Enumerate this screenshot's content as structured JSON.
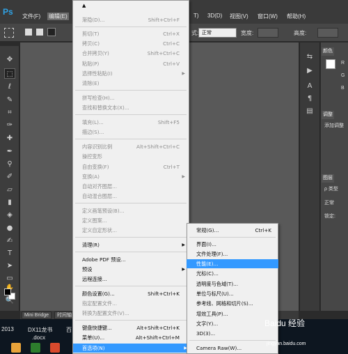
{
  "app": {
    "logo": "Ps"
  },
  "menubar": {
    "file": "文件(F)",
    "edit": "编辑(E)",
    "type_partial": "T)",
    "view3d": "3D(D)",
    "view": "视图(V)",
    "window": "窗口(W)",
    "help": "帮助(H)"
  },
  "options": {
    "mode_label": "式:",
    "mode_value": "正常",
    "opacity_label": "宽度:",
    "height_label": "高度:"
  },
  "edit_menu": {
    "items": [
      {
        "label": "渐隐(D)...",
        "shortcut": "Shift+Ctrl+F",
        "enabled": false
      },
      {
        "label": "剪切(T)",
        "shortcut": "Ctrl+X",
        "enabled": false
      },
      {
        "label": "拷贝(C)",
        "shortcut": "Ctrl+C",
        "enabled": false
      },
      {
        "label": "合并拷贝(Y)",
        "shortcut": "Shift+Ctrl+C",
        "enabled": false
      },
      {
        "label": "粘贴(P)",
        "shortcut": "Ctrl+V",
        "enabled": false
      },
      {
        "label": "选择性粘贴(I)",
        "shortcut": "",
        "enabled": false
      },
      {
        "label": "清除(E)",
        "shortcut": "",
        "enabled": false
      },
      {
        "label": "拼写检查(H)...",
        "shortcut": "",
        "enabled": false
      },
      {
        "label": "查找和替换文本(X)...",
        "shortcut": "",
        "enabled": false
      },
      {
        "label": "填充(L)...",
        "shortcut": "Shift+F5",
        "enabled": false
      },
      {
        "label": "描边(S)...",
        "shortcut": "",
        "enabled": false
      },
      {
        "label": "内容识别比例",
        "shortcut": "Alt+Shift+Ctrl+C",
        "enabled": false
      },
      {
        "label": "操控变形",
        "shortcut": "",
        "enabled": false
      },
      {
        "label": "自由变换(F)",
        "shortcut": "Ctrl+T",
        "enabled": false
      },
      {
        "label": "变换(A)",
        "shortcut": "",
        "enabled": false
      },
      {
        "label": "自动对齐图层...",
        "shortcut": "",
        "enabled": false
      },
      {
        "label": "自动混合图层...",
        "shortcut": "",
        "enabled": false
      },
      {
        "label": "定义画笔预设(B)...",
        "shortcut": "",
        "enabled": false
      },
      {
        "label": "定义图案...",
        "shortcut": "",
        "enabled": false
      },
      {
        "label": "定义自定形状...",
        "shortcut": "",
        "enabled": false
      },
      {
        "label": "清理(R)",
        "shortcut": "",
        "enabled": true
      },
      {
        "label": "Adobe PDF 预设...",
        "shortcut": "",
        "enabled": true
      },
      {
        "label": "预设",
        "shortcut": "",
        "enabled": true
      },
      {
        "label": "远程连接...",
        "shortcut": "",
        "enabled": true
      },
      {
        "label": "颜色设置(G)...",
        "shortcut": "Shift+Ctrl+K",
        "enabled": true
      },
      {
        "label": "指定配置文件...",
        "shortcut": "",
        "enabled": false
      },
      {
        "label": "转换为配置文件(V)...",
        "shortcut": "",
        "enabled": false
      },
      {
        "label": "键盘快捷键...",
        "shortcut": "Alt+Shift+Ctrl+K",
        "enabled": true
      },
      {
        "label": "菜单(U)...",
        "shortcut": "Alt+Shift+Ctrl+M",
        "enabled": true
      },
      {
        "label": "首选项(N)",
        "shortcut": "",
        "enabled": true,
        "highlighted": true
      }
    ]
  },
  "preferences_submenu": {
    "items": [
      {
        "label": "常规(G)...",
        "shortcut": "Ctrl+K"
      },
      {
        "label": "界面(I)...",
        "shortcut": ""
      },
      {
        "label": "文件处理(F)...",
        "shortcut": ""
      },
      {
        "label": "性能(E)...",
        "shortcut": "",
        "highlighted": true
      },
      {
        "label": "光标(C)...",
        "shortcut": ""
      },
      {
        "label": "透明度与色域(T)...",
        "shortcut": ""
      },
      {
        "label": "单位与标尺(U)...",
        "shortcut": ""
      },
      {
        "label": "参考线、网格和切片(S)...",
        "shortcut": ""
      },
      {
        "label": "增效工具(P)...",
        "shortcut": ""
      },
      {
        "label": "文字(Y)...",
        "shortcut": ""
      },
      {
        "label": "3D(3)...",
        "shortcut": ""
      },
      {
        "label": "Camera Raw(W)...",
        "shortcut": ""
      }
    ]
  },
  "panels": {
    "color_tab": "颜色",
    "color_r": "R",
    "color_g": "G",
    "color_b": "B",
    "adjust_tab": "调整",
    "adjust_add": "添加调整",
    "layers_tab": "图层",
    "layers_kind": "ρ 类型",
    "layers_mode": "正常",
    "layers_lock": "锁定:"
  },
  "document": {
    "tab1": "Mini Bridge",
    "tab2": "时间轴"
  },
  "taskbar": {
    "year": "2013",
    "file1": "DX11龙书",
    "file1_ext": ".docx",
    "file2_partial": "百"
  },
  "watermark": {
    "brand": "Baidu 经验",
    "url": "jingyan.baidu.com"
  },
  "colors": {
    "highlight": "#3399ff",
    "menu_bg": "#f0f0f0",
    "ps_blue": "#2fa3e6"
  }
}
